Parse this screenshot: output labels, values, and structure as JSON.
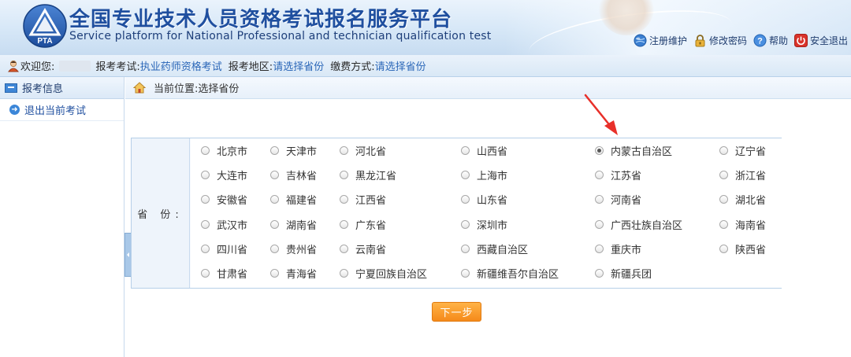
{
  "header": {
    "title_cn": "全国专业技术人员资格考试报名服务平台",
    "title_en": "Service platform for National Professional and technician qualification test",
    "logo_text": "PTA",
    "links": [
      {
        "label": "注册维护",
        "icon": "globe-icon"
      },
      {
        "label": "修改密码",
        "icon": "lock-icon"
      },
      {
        "label": "帮助",
        "icon": "help-icon"
      },
      {
        "label": "安全退出",
        "icon": "power-icon"
      }
    ]
  },
  "infobar": {
    "welcome_label": "欢迎您:",
    "exam_label": "报考考试:",
    "exam_value": "执业药师资格考试",
    "region_label": "报考地区:",
    "region_value": "请选择省份",
    "payment_label": "缴费方式:",
    "payment_value": "请选择省份"
  },
  "sidebar": {
    "header": "报考信息",
    "items": [
      {
        "label": "退出当前考试",
        "icon": "arrow-right-circle-icon"
      }
    ]
  },
  "breadcrumb": {
    "label": "当前位置:",
    "current": "选择省份"
  },
  "province_form": {
    "label": "省 份:",
    "selected": "内蒙古自治区",
    "rows": [
      [
        "北京市",
        "天津市",
        "河北省",
        "山西省",
        "内蒙古自治区",
        "辽宁省"
      ],
      [
        "大连市",
        "吉林省",
        "黑龙江省",
        "上海市",
        "江苏省",
        "浙江省"
      ],
      [
        "安徽省",
        "福建省",
        "江西省",
        "山东省",
        "河南省",
        "湖北省"
      ],
      [
        "武汉市",
        "湖南省",
        "广东省",
        "深圳市",
        "广西壮族自治区",
        "海南省"
      ],
      [
        "四川省",
        "贵州省",
        "云南省",
        "西藏自治区",
        "重庆市",
        "陕西省"
      ],
      [
        "甘肃省",
        "青海省",
        "宁夏回族自治区",
        "新疆维吾尔自治区",
        "新疆兵团"
      ]
    ]
  },
  "next_button": "下一步",
  "colors": {
    "brand_blue": "#1f4f9f",
    "link_blue": "#2b67b8",
    "button_orange": "#f58a1a",
    "annotation_red": "#e8302a"
  }
}
